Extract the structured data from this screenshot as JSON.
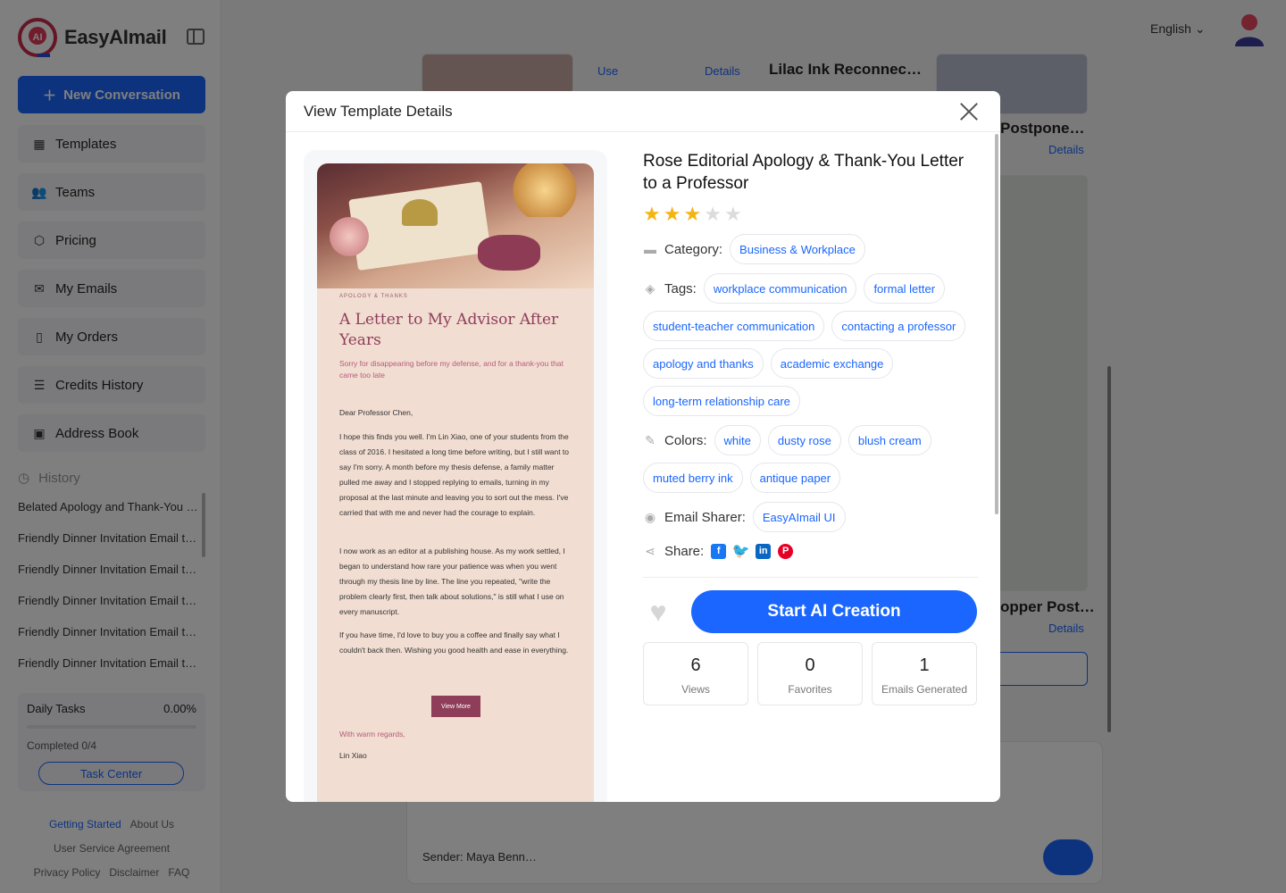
{
  "app": {
    "brand": "EasyAImail",
    "new_conversation": "New Conversation",
    "language": "English"
  },
  "nav": [
    {
      "label": "Templates",
      "icon": "grid-icon"
    },
    {
      "label": "Teams",
      "icon": "users-icon"
    },
    {
      "label": "Pricing",
      "icon": "box-icon"
    },
    {
      "label": "My Emails",
      "icon": "mail-icon"
    },
    {
      "label": "My Orders",
      "icon": "clipboard-icon"
    },
    {
      "label": "Credits History",
      "icon": "database-icon"
    },
    {
      "label": "Address Book",
      "icon": "contact-icon"
    }
  ],
  "history": {
    "heading": "History",
    "items": [
      "Belated Apology and Thank-You …",
      "Friendly Dinner Invitation Email t…",
      "Friendly Dinner Invitation Email t…",
      "Friendly Dinner Invitation Email t…",
      "Friendly Dinner Invitation Email t…",
      "Friendly Dinner Invitation Email t…"
    ]
  },
  "tasks": {
    "title": "Daily Tasks",
    "percent": "0.00%",
    "completed": "Completed 0/4",
    "button": "Task Center"
  },
  "footer": {
    "getting_started": "Getting Started",
    "about": "About Us",
    "agreement": "User Service Agreement",
    "privacy": "Privacy Policy",
    "disclaimer": "Disclaimer",
    "faq": "FAQ"
  },
  "background": {
    "card1_title": "Lilac Ink Reconnec…",
    "card2_title": "Postpone…",
    "card3_title": "opper Post…",
    "use": "Use",
    "details": "Details",
    "sender": "Sender: Maya Benn…"
  },
  "modal": {
    "heading": "View Template Details",
    "title": "Rose Editorial Apology & Thank-You Letter to a Professor",
    "rating": 3,
    "rating_max": 5,
    "category_label": "Category:",
    "category": "Business & Workplace",
    "tags_label": "Tags:",
    "tags": [
      "workplace communication",
      "formal letter",
      "student-teacher communication",
      "contacting a professor",
      "apology and thanks",
      "academic exchange",
      "long-term relationship care"
    ],
    "colors_label": "Colors:",
    "colors": [
      "white",
      "dusty rose",
      "blush cream",
      "muted berry ink",
      "antique paper"
    ],
    "sharer_label": "Email Sharer:",
    "sharer": "EasyAImail UI",
    "share_label": "Share:",
    "start_button": "Start AI Creation",
    "stats": [
      {
        "value": "6",
        "label": "Views"
      },
      {
        "value": "0",
        "label": "Favorites"
      },
      {
        "value": "1",
        "label": "Emails Generated"
      }
    ]
  },
  "preview": {
    "eyebrow": "APOLOGY & THANKS",
    "title": "A Letter to My Advisor After Years",
    "subtitle": "Sorry for disappearing before my defense, and for a thank-you that came too late",
    "greeting": "Dear Professor Chen,",
    "p1": "I hope this finds you well. I'm Lin Xiao, one of your students from the class of 2016. I hesitated a long time before writing, but I still want to say I'm sorry. A month before my thesis defense, a family matter pulled me away and I stopped replying to emails, turning in my proposal at the last minute and leaving you to sort out the mess. I've carried that with me and never had the courage to explain.",
    "p2": "I now work as an editor at a publishing house. As my work settled, I began to understand how rare your patience was when you went through my thesis line by line. The line you repeated, \"write the problem clearly first, then talk about solutions,\" is still what I use on every manuscript.",
    "p3": "If you have time, I'd love to buy you a coffee and finally say what I couldn't back then. Wishing you good health and ease in everything.",
    "button": "View More",
    "regards": "With warm regards,",
    "name": "Lin Xiao"
  },
  "colors": {
    "accent": "#1a66ff",
    "star": "#f5b414",
    "berry": "#8e3e59"
  }
}
